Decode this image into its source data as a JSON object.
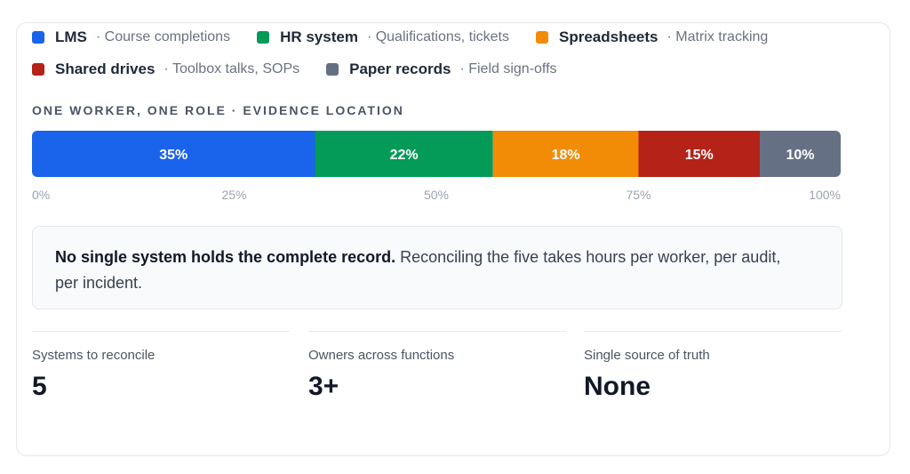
{
  "legend": [
    {
      "name": "LMS",
      "desc": "· Course completions",
      "color": "#1a63eb"
    },
    {
      "name": "HR system",
      "desc": "· Qualifications, tickets",
      "color": "#049a58"
    },
    {
      "name": "Spreadsheets",
      "desc": "· Matrix tracking",
      "color": "#f28c06"
    },
    {
      "name": "Shared drives",
      "desc": "· Toolbox talks, SOPs",
      "color": "#b42218"
    },
    {
      "name": "Paper records",
      "desc": "· Field sign-offs",
      "color": "#667085"
    }
  ],
  "chart_data": {
    "type": "bar",
    "orientation": "horizontal-stacked",
    "title": "ONE WORKER, ONE ROLE · EVIDENCE LOCATION",
    "categories": [
      "LMS",
      "HR system",
      "Spreadsheets",
      "Shared drives",
      "Paper records"
    ],
    "values": [
      35,
      22,
      18,
      15,
      10
    ],
    "data_labels": [
      "35%",
      "22%",
      "18%",
      "15%",
      "10%"
    ],
    "colors": [
      "#1a63eb",
      "#049a58",
      "#f28c06",
      "#b42218",
      "#667085"
    ],
    "xlim": [
      0,
      100
    ],
    "x_ticks": [
      0,
      25,
      50,
      75,
      100
    ],
    "x_tick_labels": [
      "0%",
      "25%",
      "50%",
      "75%",
      "100%"
    ],
    "grid": false
  },
  "callout": {
    "bold": "No single system holds the complete record.",
    "text": " Reconciling the five takes hours per worker, per audit, per incident."
  },
  "stats": [
    {
      "label": "Systems to reconcile",
      "value": "5"
    },
    {
      "label": "Owners across functions",
      "value": "3+"
    },
    {
      "label": "Single source of truth",
      "value": "None"
    }
  ]
}
